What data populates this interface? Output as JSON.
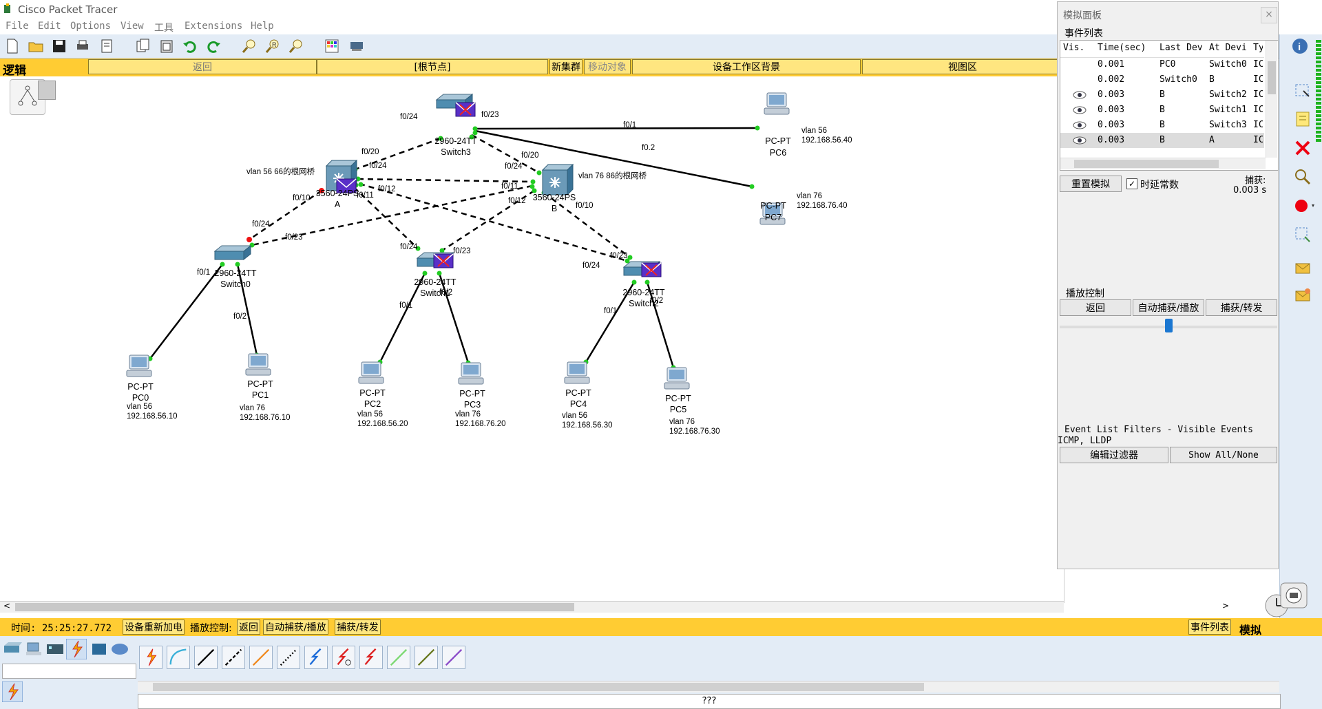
{
  "app": {
    "title": "Cisco Packet Tracer"
  },
  "menu": [
    "File",
    "Edit",
    "Options",
    "View",
    "工具",
    "Extensions",
    "Help"
  ],
  "workspace_bar": {
    "mode": "逻辑",
    "back": "返回",
    "root_node": "[根节点]",
    "new_cluster": "新集群",
    "move_object": "移动对象",
    "background": "设备工作区背景",
    "viewport": "视图区"
  },
  "devices": {
    "switch3": {
      "model": "2960-24TT",
      "name": "Switch3"
    },
    "switchA": {
      "model": "3560-24PS",
      "name": "A",
      "note": "vlan 56 66的根网桥"
    },
    "switchB": {
      "model": "3560-24PS",
      "name": "B",
      "note": "vlan 76 86的根网桥"
    },
    "switch0": {
      "model": "2960-24TT",
      "name": "Switch0"
    },
    "switch1": {
      "model": "2960-24TT",
      "name": "Switch1"
    },
    "switch2": {
      "model": "2960-24TT",
      "name": "Switch2"
    },
    "pc0": {
      "model": "PC-PT",
      "name": "PC0",
      "vlan": "vlan 56",
      "ip": "192.168.56.10"
    },
    "pc1": {
      "model": "PC-PT",
      "name": "PC1",
      "vlan": "vlan 76",
      "ip": "192.168.76.10"
    },
    "pc2": {
      "model": "PC-PT",
      "name": "PC2",
      "vlan": "vlan 56",
      "ip": "192.168.56.20"
    },
    "pc3": {
      "model": "PC-PT",
      "name": "PC3",
      "vlan": "vlan 76",
      "ip": "192.168.76.20"
    },
    "pc4": {
      "model": "PC-PT",
      "name": "PC4",
      "vlan": "vlan 56",
      "ip": "192.168.56.30"
    },
    "pc5": {
      "model": "PC-PT",
      "name": "PC5",
      "vlan": "vlan 76",
      "ip": "192.168.76.30"
    },
    "pc6": {
      "model": "PC-PT",
      "name": "PC6",
      "vlan": "vlan 56",
      "ip": "192.168.56.40"
    },
    "pc7": {
      "model": "PC-PT",
      "name": "PC7",
      "vlan": "vlan 76",
      "ip": "192.168.76.40"
    }
  },
  "ports": {
    "s3_pc6": "f0/1",
    "s3_pc7": "f0.2",
    "s3_a": "f0/24",
    "s3_b": "f0/23",
    "a_s3": "f0/20",
    "b_s3": "f0/20",
    "a_b": "f0/24",
    "b_a": "f0/24",
    "a_s0": "f0/10",
    "a_s1": "f0/11",
    "a_s2": "f0/12",
    "b_s0": "f0/11",
    "b_s1": "f0/12",
    "b_s2": "f0/10",
    "s0_a": "f0/24",
    "s0_b": "f0/23",
    "s1_a": "f0/24",
    "s1_b": "f0/23",
    "s2_b": "f0/23",
    "s2_a": "f0/24",
    "s0_pc0": "f0/1",
    "s0_pc1": "f0/2",
    "s1_pc2": "f0/1",
    "s1_pc3": "f0/2",
    "s2_pc4": "f0/1",
    "s2_pc5": "f0/2"
  },
  "sim_panel": {
    "title": "模拟面板",
    "event_list_label": "事件列表",
    "columns": [
      "Vis.",
      "Time(sec)",
      "Last Dev",
      "At Devi",
      "Ty"
    ],
    "events": [
      {
        "time": "0.001",
        "last": "PC0",
        "at": "Switch0",
        "type": "IC",
        "eye": false
      },
      {
        "time": "0.002",
        "last": "Switch0",
        "at": "B",
        "type": "IC",
        "eye": false
      },
      {
        "time": "0.003",
        "last": "B",
        "at": "Switch2",
        "type": "IC",
        "eye": true
      },
      {
        "time": "0.003",
        "last": "B",
        "at": "Switch1",
        "type": "IC",
        "eye": true
      },
      {
        "time": "0.003",
        "last": "B",
        "at": "Switch3",
        "type": "IC",
        "eye": true
      },
      {
        "time": "0.003",
        "last": "B",
        "at": "A",
        "type": "IC",
        "eye": true
      }
    ],
    "reset": "重置模拟",
    "constant_delay": "时延常数",
    "capture_label": "捕获:",
    "capture_value": "0.003 s",
    "playback_label": "播放控制",
    "back": "返回",
    "auto_capture": "自动捕获/播放",
    "capture_forward": "捕获/转发",
    "filters_label": "Event List Filters - Visible Events",
    "filters_value": "ICMP, LLDP",
    "edit_filters": "编辑过滤器",
    "show_all": "Show All/None"
  },
  "status": {
    "time": "时间: 25:25:27.772",
    "power_cycle": "设备重新加电",
    "playback_control": "播放控制:",
    "back": "返回",
    "auto": "自动捕获/播放",
    "capture": "捕获/转发",
    "event_list": "事件列表",
    "mode": "模拟"
  },
  "bottom": {
    "unknown_label": "???"
  },
  "colors": {
    "yellow": "#ffcc33",
    "link_green": "#22cc22",
    "link_red": "#ee1111",
    "toolbar": "#e3ecf6"
  }
}
